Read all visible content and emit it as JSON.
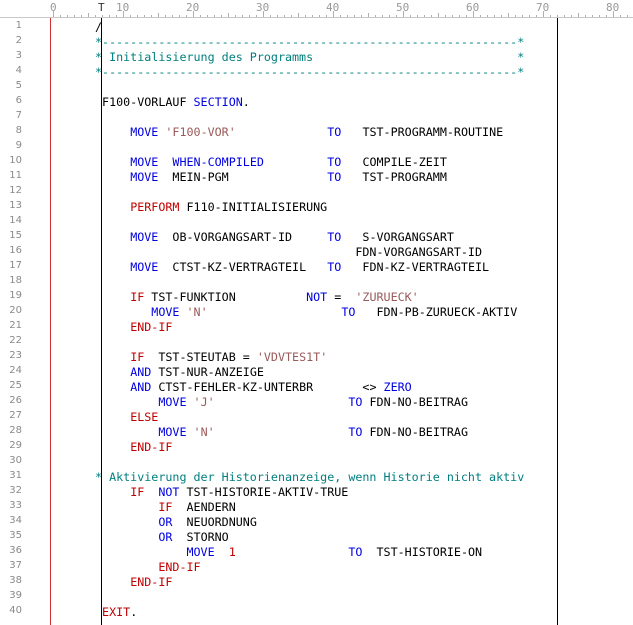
{
  "ruler": {
    "labels": [
      "0",
      "10",
      "20",
      "30",
      "40",
      "50",
      "60",
      "70",
      "80"
    ],
    "cursor_glyph": "T"
  },
  "colors": {
    "comment": "#007f7f",
    "keyword": "#0000e0",
    "string": "#9a5a5a",
    "verb_red": "#c00000",
    "default": "#000000",
    "margin_red": "#d03030"
  },
  "lines": [
    {
      "n": "1",
      "segs": [
        {
          "t": "/",
          "c": "default"
        }
      ]
    },
    {
      "n": "2",
      "segs": [
        {
          "t": "*-----------------------------------------------------------*",
          "c": "comment"
        }
      ]
    },
    {
      "n": "3",
      "segs": [
        {
          "t": "* Initialisierung des Programms",
          "c": "comment"
        },
        {
          "t": "                             *",
          "c": "comment"
        }
      ]
    },
    {
      "n": "4",
      "segs": [
        {
          "t": "*-----------------------------------------------------------*",
          "c": "comment"
        }
      ]
    },
    {
      "n": "5",
      "segs": []
    },
    {
      "n": "6",
      "segs": [
        {
          "t": " F100-VORLAUF ",
          "c": "default"
        },
        {
          "t": "SECTION",
          "c": "kw"
        },
        {
          "t": ".",
          "c": "default"
        }
      ]
    },
    {
      "n": "7",
      "segs": []
    },
    {
      "n": "8",
      "segs": [
        {
          "t": "     ",
          "c": "default"
        },
        {
          "t": "MOVE",
          "c": "kw"
        },
        {
          "t": " ",
          "c": "default"
        },
        {
          "t": "'F100-VOR'",
          "c": "str"
        },
        {
          "t": "             ",
          "c": "default"
        },
        {
          "t": "TO",
          "c": "kw"
        },
        {
          "t": "   TST-PROGRAMM-ROUTINE",
          "c": "default"
        }
      ]
    },
    {
      "n": "9",
      "segs": []
    },
    {
      "n": "10",
      "segs": [
        {
          "t": "     ",
          "c": "default"
        },
        {
          "t": "MOVE",
          "c": "kw"
        },
        {
          "t": "  ",
          "c": "default"
        },
        {
          "t": "WHEN-COMPILED",
          "c": "kw"
        },
        {
          "t": "         ",
          "c": "default"
        },
        {
          "t": "TO",
          "c": "kw"
        },
        {
          "t": "   COMPILE-ZEIT",
          "c": "default"
        }
      ]
    },
    {
      "n": "11",
      "segs": [
        {
          "t": "     ",
          "c": "default"
        },
        {
          "t": "MOVE",
          "c": "kw"
        },
        {
          "t": "  MEIN-PGM              ",
          "c": "default"
        },
        {
          "t": "TO",
          "c": "kw"
        },
        {
          "t": "   TST-PROGRAMM",
          "c": "default"
        }
      ]
    },
    {
      "n": "12",
      "segs": []
    },
    {
      "n": "13",
      "segs": [
        {
          "t": "     ",
          "c": "default"
        },
        {
          "t": "PERFORM",
          "c": "red"
        },
        {
          "t": " F110-INITIALISIERUNG",
          "c": "default"
        }
      ]
    },
    {
      "n": "14",
      "segs": []
    },
    {
      "n": "15",
      "segs": [
        {
          "t": "     ",
          "c": "default"
        },
        {
          "t": "MOVE",
          "c": "kw"
        },
        {
          "t": "  OB-VORGANGSART-ID     ",
          "c": "default"
        },
        {
          "t": "TO",
          "c": "kw"
        },
        {
          "t": "   S-VORGANGSART",
          "c": "default"
        }
      ]
    },
    {
      "n": "16",
      "segs": [
        {
          "t": "                                     FDN-VORGANGSART-ID",
          "c": "default"
        }
      ]
    },
    {
      "n": "17",
      "segs": [
        {
          "t": "     ",
          "c": "default"
        },
        {
          "t": "MOVE",
          "c": "kw"
        },
        {
          "t": "  CTST-KZ-VERTRAGTEIL   ",
          "c": "default"
        },
        {
          "t": "TO",
          "c": "kw"
        },
        {
          "t": "   FDN-KZ-VERTRAGTEIL",
          "c": "default"
        }
      ]
    },
    {
      "n": "18",
      "segs": []
    },
    {
      "n": "19",
      "segs": [
        {
          "t": "     ",
          "c": "default"
        },
        {
          "t": "IF",
          "c": "red"
        },
        {
          "t": " TST-FUNKTION          ",
          "c": "default"
        },
        {
          "t": "NOT",
          "c": "kw"
        },
        {
          "t": " =  ",
          "c": "default"
        },
        {
          "t": "'ZURUECK'",
          "c": "str"
        }
      ]
    },
    {
      "n": "20",
      "segs": [
        {
          "t": "        ",
          "c": "default"
        },
        {
          "t": "MOVE",
          "c": "kw"
        },
        {
          "t": " ",
          "c": "default"
        },
        {
          "t": "'N'",
          "c": "str"
        },
        {
          "t": "                   ",
          "c": "default"
        },
        {
          "t": "TO",
          "c": "kw"
        },
        {
          "t": "   FDN-PB-ZURUECK-AKTIV",
          "c": "default"
        }
      ]
    },
    {
      "n": "21",
      "segs": [
        {
          "t": "     ",
          "c": "default"
        },
        {
          "t": "END-IF",
          "c": "red"
        }
      ]
    },
    {
      "n": "22",
      "segs": []
    },
    {
      "n": "23",
      "segs": [
        {
          "t": "     ",
          "c": "default"
        },
        {
          "t": "IF",
          "c": "red"
        },
        {
          "t": "  TST-STEUTAB = ",
          "c": "default"
        },
        {
          "t": "'VDVTES1T'",
          "c": "str"
        }
      ]
    },
    {
      "n": "24",
      "segs": [
        {
          "t": "     ",
          "c": "default"
        },
        {
          "t": "AND",
          "c": "kw"
        },
        {
          "t": " TST-NUR-ANZEIGE",
          "c": "default"
        }
      ]
    },
    {
      "n": "25",
      "segs": [
        {
          "t": "     ",
          "c": "default"
        },
        {
          "t": "AND",
          "c": "kw"
        },
        {
          "t": " CTST-FEHLER-KZ-UNTERBR       <> ",
          "c": "default"
        },
        {
          "t": "ZERO",
          "c": "kw"
        }
      ]
    },
    {
      "n": "26",
      "segs": [
        {
          "t": "         ",
          "c": "default"
        },
        {
          "t": "MOVE",
          "c": "kw"
        },
        {
          "t": " ",
          "c": "default"
        },
        {
          "t": "'J'",
          "c": "str"
        },
        {
          "t": "                   ",
          "c": "default"
        },
        {
          "t": "TO",
          "c": "kw"
        },
        {
          "t": " FDN-NO-BEITRAG",
          "c": "default"
        }
      ]
    },
    {
      "n": "27",
      "segs": [
        {
          "t": "     ",
          "c": "default"
        },
        {
          "t": "ELSE",
          "c": "red"
        }
      ]
    },
    {
      "n": "28",
      "segs": [
        {
          "t": "         ",
          "c": "default"
        },
        {
          "t": "MOVE",
          "c": "kw"
        },
        {
          "t": " ",
          "c": "default"
        },
        {
          "t": "'N'",
          "c": "str"
        },
        {
          "t": "                   ",
          "c": "default"
        },
        {
          "t": "TO",
          "c": "kw"
        },
        {
          "t": " FDN-NO-BEITRAG",
          "c": "default"
        }
      ]
    },
    {
      "n": "29",
      "segs": [
        {
          "t": "     ",
          "c": "default"
        },
        {
          "t": "END-IF",
          "c": "red"
        }
      ]
    },
    {
      "n": "30",
      "segs": []
    },
    {
      "n": "31",
      "segs": [
        {
          "t": "* Aktivierung der Historienanzeige, wenn Historie nicht aktiv",
          "c": "comment"
        }
      ]
    },
    {
      "n": "32",
      "segs": [
        {
          "t": "     ",
          "c": "default"
        },
        {
          "t": "IF",
          "c": "red"
        },
        {
          "t": "  ",
          "c": "default"
        },
        {
          "t": "NOT",
          "c": "kw"
        },
        {
          "t": " TST-HISTORIE-AKTIV-TRUE",
          "c": "default"
        }
      ]
    },
    {
      "n": "33",
      "segs": [
        {
          "t": "         ",
          "c": "default"
        },
        {
          "t": "IF",
          "c": "red"
        },
        {
          "t": "  AENDERN",
          "c": "default"
        }
      ]
    },
    {
      "n": "34",
      "segs": [
        {
          "t": "         ",
          "c": "default"
        },
        {
          "t": "OR",
          "c": "kw"
        },
        {
          "t": "  NEUORDNUNG",
          "c": "default"
        }
      ]
    },
    {
      "n": "35",
      "segs": [
        {
          "t": "         ",
          "c": "default"
        },
        {
          "t": "OR",
          "c": "kw"
        },
        {
          "t": "  STORNO",
          "c": "default"
        }
      ]
    },
    {
      "n": "36",
      "segs": [
        {
          "t": "             ",
          "c": "default"
        },
        {
          "t": "MOVE",
          "c": "kw"
        },
        {
          "t": "  ",
          "c": "default"
        },
        {
          "t": "1",
          "c": "red"
        },
        {
          "t": "                ",
          "c": "default"
        },
        {
          "t": "TO",
          "c": "kw"
        },
        {
          "t": "  TST-HISTORIE-ON",
          "c": "default"
        }
      ]
    },
    {
      "n": "37",
      "segs": [
        {
          "t": "         ",
          "c": "default"
        },
        {
          "t": "END-IF",
          "c": "red"
        }
      ]
    },
    {
      "n": "38",
      "segs": [
        {
          "t": "     ",
          "c": "default"
        },
        {
          "t": "END-IF",
          "c": "red"
        }
      ]
    },
    {
      "n": "39",
      "segs": []
    },
    {
      "n": "40",
      "segs": [
        {
          "t": " ",
          "c": "default"
        },
        {
          "t": "EXIT",
          "c": "red"
        },
        {
          "t": ".",
          "c": "default"
        }
      ]
    }
  ]
}
